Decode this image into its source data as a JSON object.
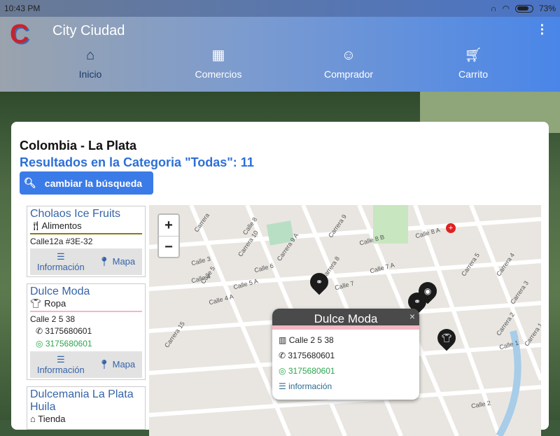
{
  "status": {
    "time": "10:43 PM",
    "battery": "73%"
  },
  "app": {
    "title": "City Ciudad",
    "logo": "C"
  },
  "tabs": [
    {
      "label": "Inicio",
      "icon": "home-icon"
    },
    {
      "label": "Comercios",
      "icon": "store-icon"
    },
    {
      "label": "Comprador",
      "icon": "face-icon"
    },
    {
      "label": "Carrito",
      "icon": "cart-icon"
    }
  ],
  "main": {
    "location": "Colombia - La Plata",
    "results": "Resultados en la Categoria \"Todas\": 11",
    "change_button": "cambiar la búsqueda"
  },
  "shops": [
    {
      "name": "Cholaos Ice Fruits",
      "category": "Alimentos",
      "address": "Calle12a #3E-32",
      "info": "Información",
      "map": "Mapa",
      "color": "#8a7a10"
    },
    {
      "name": "Dulce Moda",
      "category": "Ropa",
      "address": "Calle 2 5 38",
      "phone": "3175680601",
      "whatsapp": "3175680601",
      "info": "Información",
      "map": "Mapa",
      "color": "#f3b7c3"
    },
    {
      "name": "Dulcemania La Plata Huila",
      "category": "Tienda"
    }
  ],
  "map": {
    "zoom_in": "+",
    "zoom_out": "−",
    "streets": [
      "Carrera",
      "Calle 8",
      "Carrera 10",
      "Carrera 9 A",
      "Calle 8 B",
      "Calle 8 A",
      "Carrera 9",
      "Calle 7 A",
      "Calle 7",
      "Calle 6",
      "Calle 5 A",
      "Calle 4 A",
      "Carrera 5",
      "Carrera 4",
      "Carrera 3",
      "Carrera 2",
      "Calle 1",
      "Carrera 1",
      "Calle 2",
      "Carrera 15",
      "Calle 3",
      "Calle 4",
      "Calle 5",
      "Carrera 8"
    ],
    "popup": {
      "title": "Dulce Moda",
      "close": "×",
      "address": "Calle 2 5 38",
      "phone": "3175680601",
      "whatsapp": "3175680601",
      "info": "información"
    }
  }
}
